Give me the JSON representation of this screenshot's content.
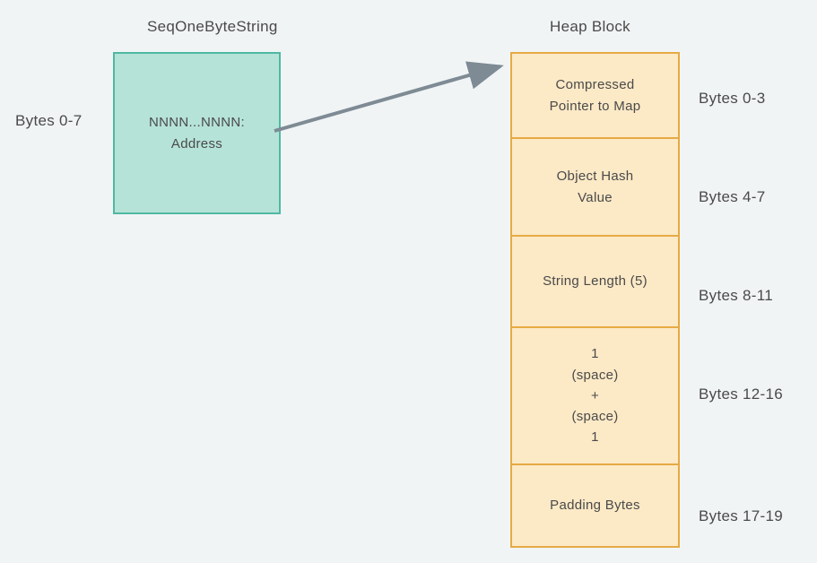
{
  "left": {
    "title": "SeqOneByteString",
    "label": "Bytes 0-7",
    "box_line1": "NNNN...NNNN:",
    "box_line2": "Address"
  },
  "right": {
    "title": "Heap Block",
    "cells": [
      {
        "lines": [
          "Compressed",
          "Pointer to Map"
        ],
        "label": "Bytes 0-3"
      },
      {
        "lines": [
          "Object Hash",
          "Value"
        ],
        "label": "Bytes 4-7"
      },
      {
        "lines": [
          "String Length (5)"
        ],
        "label": "Bytes 8-11"
      },
      {
        "lines": [
          "1",
          "(space)",
          "+",
          "(space)",
          "1"
        ],
        "label": "Bytes 12-16"
      },
      {
        "lines": [
          "Padding Bytes"
        ],
        "label": "Bytes 17-19"
      }
    ]
  }
}
